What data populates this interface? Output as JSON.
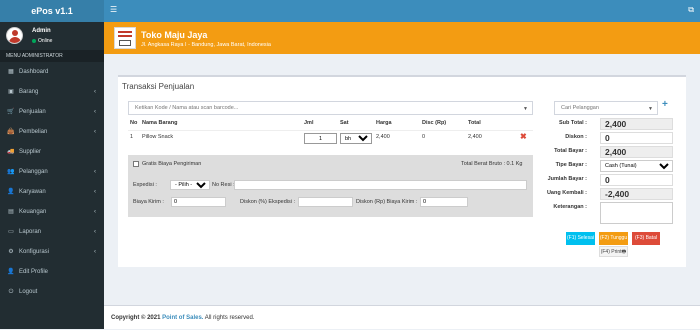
{
  "app": {
    "title": "ePos v1.1"
  },
  "user": {
    "name": "Admin",
    "status": "Online"
  },
  "sidebar": {
    "header": "MENU ADMINISTRATOR",
    "items": [
      {
        "label": "Dashboard",
        "icon": "dashboard-icon",
        "glyph": "▦",
        "has_children": false
      },
      {
        "label": "Barang",
        "icon": "cube-icon",
        "glyph": "▣",
        "has_children": true
      },
      {
        "label": "Penjualan",
        "icon": "cart-icon",
        "glyph": "🛒",
        "has_children": true
      },
      {
        "label": "Pembelian",
        "icon": "bag-icon",
        "glyph": "👜",
        "has_children": true
      },
      {
        "label": "Supplier",
        "icon": "truck-icon",
        "glyph": "🚚",
        "has_children": false
      },
      {
        "label": "Pelanggan",
        "icon": "users-icon",
        "glyph": "👥",
        "has_children": true
      },
      {
        "label": "Karyawan",
        "icon": "user-group-icon",
        "glyph": "👤",
        "has_children": true
      },
      {
        "label": "Keuangan",
        "icon": "money-icon",
        "glyph": "▤",
        "has_children": true
      },
      {
        "label": "Laporan",
        "icon": "report-icon",
        "glyph": "▭",
        "has_children": true
      },
      {
        "label": "Konfigurasi",
        "icon": "gear-icon",
        "glyph": "⚙",
        "has_children": true
      },
      {
        "label": "Edit Profile",
        "icon": "user-icon",
        "glyph": "👤",
        "has_children": false
      },
      {
        "label": "Logout",
        "icon": "power-icon",
        "glyph": "⏻",
        "has_children": false
      }
    ]
  },
  "store": {
    "name": "Toko Maju Jaya",
    "address": "Jl. Angkasa Raya I - Bandung, Jawa Barat, Indonesia"
  },
  "transaction": {
    "title": "Transaksi Penjualan",
    "product_search_placeholder": "Ketikan Kode / Nama atau scan barcode...",
    "customer_search_placeholder": "Cari Pelanggan",
    "columns": {
      "no": "No",
      "name": "Nama Barang",
      "qty": "Jml",
      "unit": "Sat",
      "price": "Harga",
      "discount": "Disc (Rp)",
      "total": "Total"
    },
    "row": {
      "no": "1",
      "name": "Pillow Snack",
      "qty": "1",
      "unit": "bh",
      "price": "2,400",
      "discount": "0",
      "total": "2,400"
    }
  },
  "shipping": {
    "free_label": "Gratis Biaya Pengiriman",
    "weight_label": "Total Berat Bruto : 0.1 Kg",
    "expedition_label": "Expedisi :",
    "expedition_select": "- Pilih -",
    "resi_label": "No Resi :",
    "cost_label": "Biaya Kirim :",
    "cost_value": "0",
    "disc_pct_label": "Diskon (%) Ekspedisi :",
    "disc_rp_label": "Diskon (Rp) Biaya Kirim :",
    "disc_rp_value": "0"
  },
  "summary": {
    "subtotal_label": "Sub Total :",
    "subtotal": "2,400",
    "discount_label": "Diskon :",
    "discount": "0",
    "total_label": "Total Bayar :",
    "total": "2,400",
    "pay_type_label": "Tipe Bayar :",
    "pay_type": "Cash (Tunai)",
    "paid_label": "Jumlah Bayar :",
    "paid": "0",
    "change_label": "Uang Kembali :",
    "change": "-2,400",
    "note_label": "Keterangan :"
  },
  "buttons": {
    "save": "(F1) Selesai",
    "pending": "(F2) Tunggu",
    "cancel": "(F3) Batal",
    "print": "(F4) Print"
  },
  "footer": {
    "copyright": "Copyright © 2021",
    "brand": "Point of Sales.",
    "rights": "All rights reserved."
  }
}
